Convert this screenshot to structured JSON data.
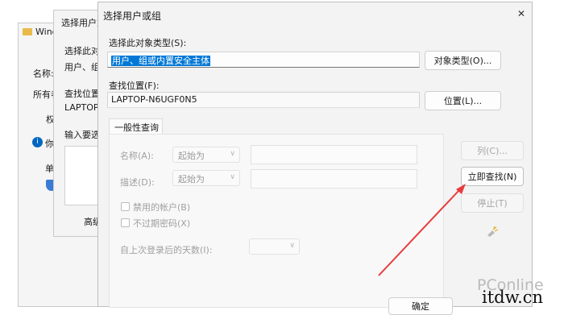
{
  "bg_window1": {
    "title": "Windo",
    "label_name": "名称:",
    "label_owner": "所有者",
    "tab": "权",
    "info": "你",
    "row": "单"
  },
  "bg_window2": {
    "title": "选择用户或",
    "label_type": "选择此对",
    "type_value": "用户、组",
    "label_loc": "查找位置",
    "loc_value": "LAPTOP",
    "label_input": "输入要选",
    "advanced_button": "高级"
  },
  "dialog": {
    "title": "选择用户或组",
    "close_glyph": "✕",
    "object_type_label": "选择此对象类型(S):",
    "object_type_value": "用户、组或内置安全主体",
    "object_type_button": "对象类型(O)...",
    "location_label": "查找位置(F):",
    "location_value": "LAPTOP-N6UGF0N5",
    "location_button": "位置(L)...",
    "tab_general": "一般性查询",
    "name_label": "名称(A):",
    "name_select": "起始为",
    "desc_label": "描述(D):",
    "desc_select": "起始为",
    "disabled_accounts": "禁用的帐户(B)",
    "non_expiring_pwd": "不过期密码(X)",
    "days_label": "自上次登录后的天数(I):",
    "columns_button": "列(C)...",
    "find_now_button": "立即查找(N)",
    "stop_button": "停止(T)",
    "ok_button": "确定"
  },
  "watermark": {
    "brand": "PConline",
    "site": "itdw.cn"
  },
  "colors": {
    "accent": "#0067c0",
    "arrow": "#e83b3b",
    "selection": "#0078d7"
  }
}
